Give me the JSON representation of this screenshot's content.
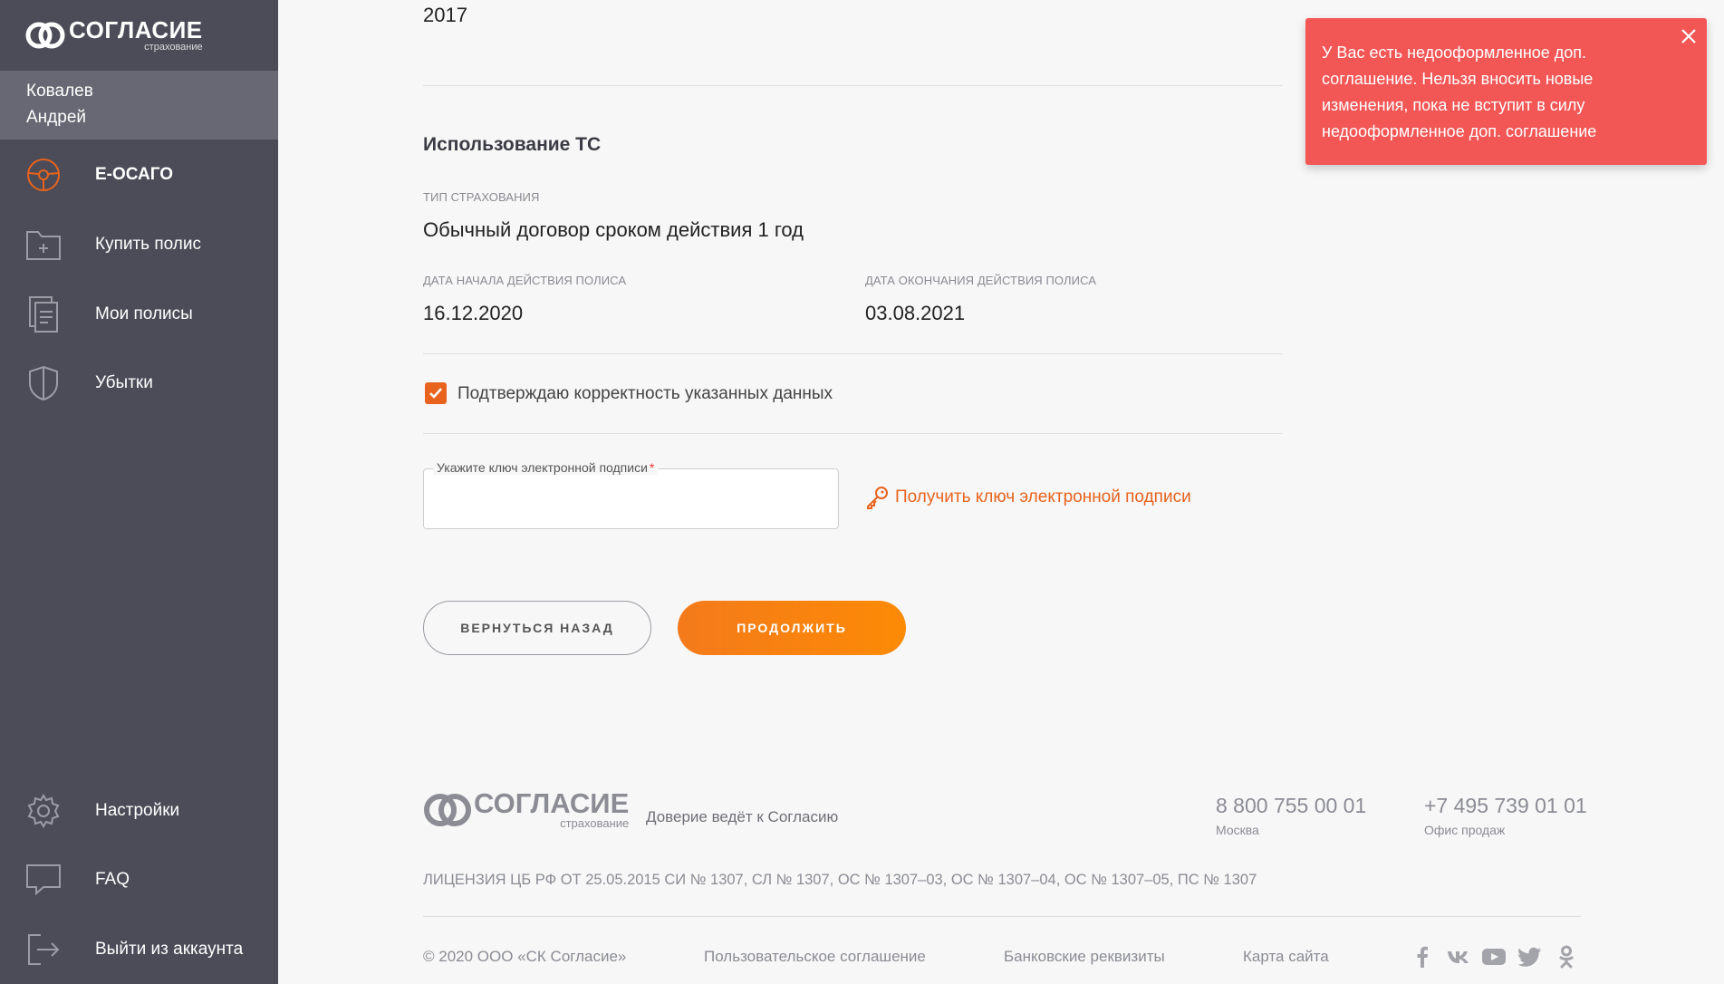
{
  "brand": {
    "name": "СОГЛАСИЕ",
    "sub": "страхование"
  },
  "user": {
    "last_name": "Ковалев",
    "first_name": "Андрей"
  },
  "nav": [
    {
      "label": "Е-ОСАГО",
      "icon": "steering-wheel-icon",
      "active": true
    },
    {
      "label": "Купить полис",
      "icon": "folder-plus-icon"
    },
    {
      "label": "Мои полисы",
      "icon": "documents-icon"
    },
    {
      "label": "Убытки",
      "icon": "shield-icon"
    }
  ],
  "nav_bottom": [
    {
      "label": "Настройки",
      "icon": "gear-icon"
    },
    {
      "label": "FAQ",
      "icon": "chat-icon"
    },
    {
      "label": "Выйти из аккаунта",
      "icon": "logout-icon"
    }
  ],
  "main": {
    "year_value": "2017",
    "section_title": "Использование ТС",
    "insurance_type_label": "ТИП СТРАХОВАНИЯ",
    "insurance_type_value": "Обычный договор сроком действия 1 год",
    "start_label": "ДАТА НАЧАЛА ДЕЙСТВИЯ ПОЛИСА",
    "start_value": "16.12.2020",
    "end_label": "ДАТА ОКОНЧАНИЯ ДЕЙСТВИЯ ПОЛИСА",
    "end_value": "03.08.2021",
    "confirm_label": "Подтверждаю корректность указанных данных",
    "confirm_checked": true,
    "signature_field_label": "Укажите ключ электронной подписи",
    "signature_field_required": "*",
    "signature_field_value": "",
    "get_key_link": "Получить ключ электронной подписи",
    "back_button": "ВЕРНУТЬСЯ НАЗАД",
    "continue_button": "ПРОДОЛЖИТЬ"
  },
  "footer": {
    "slogan": "Доверие ведёт к Согласию",
    "phone1": "8 800 755 00 01",
    "phone1_caption": "Москва",
    "phone2": "+7 495 739 01 01",
    "phone2_caption": "Офис продаж",
    "license": "ЛИЦЕНЗИЯ ЦБ РФ ОТ 25.05.2015 СИ № 1307, СЛ № 1307, ОС № 1307–03, ОС № 1307–04, ОС № 1307–05, ПС № 1307",
    "copyright": "© 2020 ООО «СК Согласие»",
    "links": [
      "Пользовательское соглашение",
      "Банковские реквизиты",
      "Карта сайта"
    ],
    "social": [
      "facebook-icon",
      "vk-icon",
      "youtube-icon",
      "twitter-icon",
      "odnoklassniki-icon"
    ]
  },
  "toast": {
    "message": "У Вас есть недооформленное доп. соглашение. Нельзя вносить новые изменения, пока не вступит в силу недооформленное доп. соглашение",
    "color": "#f25756"
  },
  "colors": {
    "accent": "#e8631d",
    "sidebar": "#4b4c58",
    "sidebar_user": "#676873"
  }
}
